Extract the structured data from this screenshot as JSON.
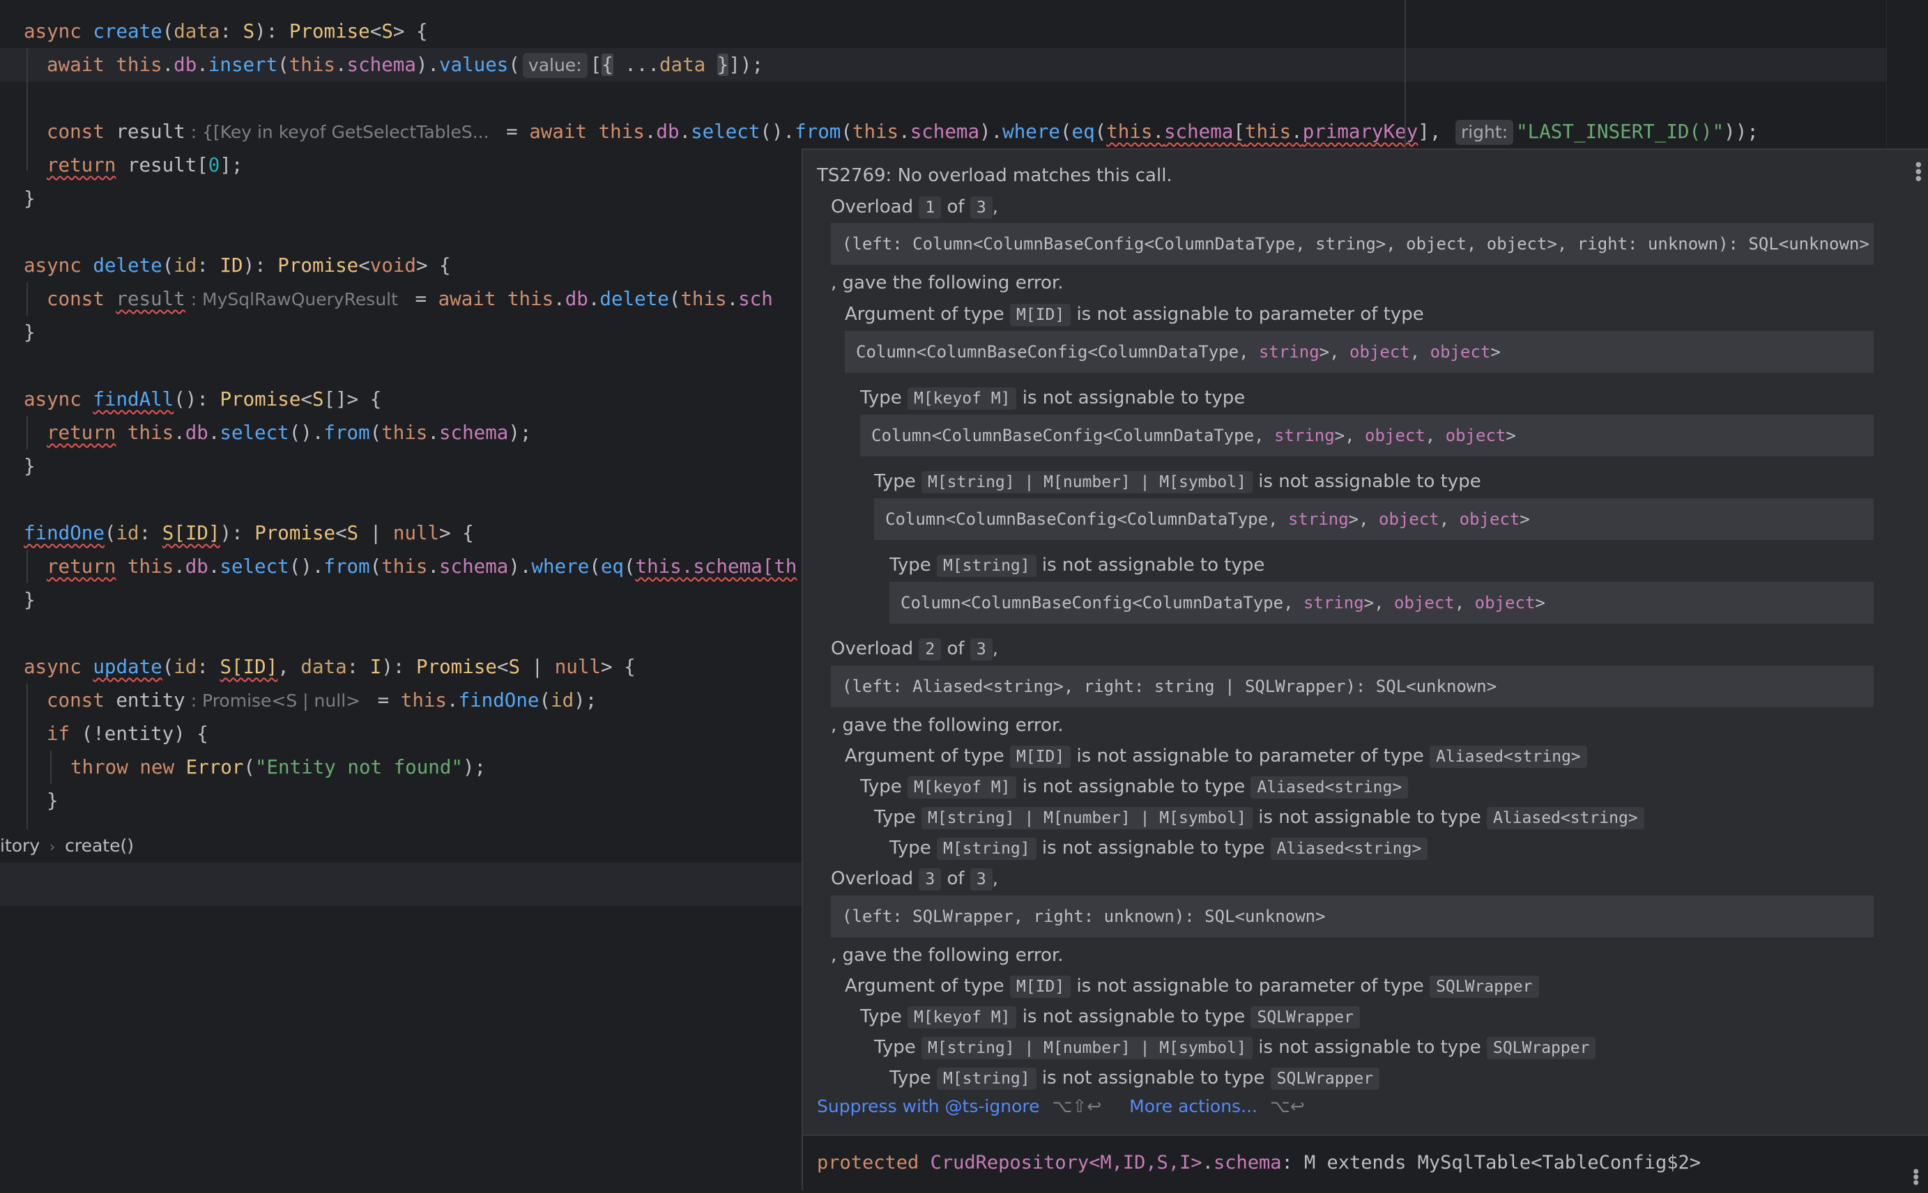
{
  "editor": {
    "l1": {
      "a": "async ",
      "b": "create",
      "c": "(",
      "d": "data",
      "e": ": ",
      "f": "S",
      "g": "): ",
      "h": "Promise",
      "i": "<",
      "j": "S",
      "k": "> {"
    },
    "l2": {
      "a": "await ",
      "b": "this",
      "c": ".",
      "d": "db",
      "e": ".",
      "f": "insert",
      "g": "(",
      "h": "this",
      "i": ".",
      "j": "schema",
      "k": ").",
      "l": "values",
      "m": "(",
      "hint": "value:",
      "n": "[",
      "o": "{",
      "p": " ...",
      "q": "data",
      "r": " ",
      "s": "}",
      "t": "]);"
    },
    "l4": {
      "a": "const ",
      "b": "result",
      "hint": ": {[Key in keyof GetSelectTableS...",
      "c": " = ",
      "d": "await ",
      "e": "this",
      "f": ".",
      "g": "db",
      "h": ".",
      "i": "select",
      "j": "().",
      "k": "from",
      "l": "(",
      "m": "this",
      "n": ".",
      "o": "schema",
      "p": ").",
      "q": "where",
      "r": "(",
      "s": "eq",
      "t": "(",
      "u": "this",
      "v": ".",
      "w": "schema",
      "x": "[",
      "y": "this",
      "z": ".",
      "aa": "primaryKey",
      "ab": "], ",
      "hint2": "right:",
      "ac": "\"LAST_INSERT_ID()\"",
      "ad": "));"
    },
    "l5": {
      "a": "return",
      "b": " result[",
      "c": "0",
      "d": "];"
    },
    "l6": "}",
    "l8": {
      "a": "async ",
      "b": "delete",
      "c": "(",
      "d": "id",
      "e": ": ",
      "f": "ID",
      "g": "): ",
      "h": "Promise",
      "i": "<",
      "j": "void",
      "k": "> {"
    },
    "l9": {
      "a": "const ",
      "b": "result",
      "hint": ": MySqlRawQueryResult",
      "c": " = ",
      "d": "await ",
      "e": "this",
      "f": ".",
      "g": "db",
      "h": ".",
      "i": "delete",
      "j": "(",
      "k": "this",
      "l": ".",
      "m": "sch"
    },
    "l10": "}",
    "l12": {
      "a": "async ",
      "b": "findAll",
      "c": "(): ",
      "d": "Promise",
      "e": "<",
      "f": "S",
      "g": "[]> {"
    },
    "l13": {
      "a": "return",
      "b": " ",
      "c": "this",
      "d": ".",
      "e": "db",
      "f": ".",
      "g": "select",
      "h": "().",
      "i": "from",
      "j": "(",
      "k": "this",
      "l": ".",
      "m": "schema",
      "n": ");"
    },
    "l14": "}",
    "l16": {
      "a": "findOne",
      "b": "(",
      "c": "id",
      "d": ": ",
      "e": "S[ID]",
      "f": "): ",
      "g": "Promise",
      "h": "<",
      "i": "S",
      "j": " | ",
      "k": "null",
      "l": "> {"
    },
    "l17": {
      "a": "return",
      "b": " ",
      "c": "this",
      "d": ".",
      "e": "db",
      "f": ".",
      "g": "select",
      "h": "().",
      "i": "from",
      "j": "(",
      "k": "this",
      "l": ".",
      "m": "schema",
      "n": ").",
      "o": "where",
      "p": "(",
      "q": "eq",
      "r": "(",
      "s": "this.schema[th"
    },
    "l18": "}",
    "l20": {
      "a": "async ",
      "b": "update",
      "c": "(",
      "d": "id",
      "e": ": ",
      "f": "S[ID]",
      "g": ", ",
      "h": "data",
      "i": ": ",
      "j": "I",
      "k": "): ",
      "l": "Promise",
      "m": "<",
      "n": "S",
      "o": " | ",
      "p": "null",
      "q": "> {"
    },
    "l21": {
      "a": "const ",
      "b": "entity",
      "hint": ": Promise<S | null>",
      "c": " = ",
      "d": "this",
      "e": ".",
      "f": "findOne",
      "g": "(",
      "h": "id",
      "i": ");"
    },
    "l22": {
      "a": "if ",
      "b": "(!entity) {"
    },
    "l23": {
      "a": "throw new ",
      "b": "Error",
      "c": "(",
      "d": "\"Entity not found\"",
      "e": ");"
    },
    "l24": "}"
  },
  "breadcrumb": {
    "item1": "itory",
    "item2": "create()"
  },
  "popup": {
    "title": "TS2769: No overload matches this call.",
    "overload_word": "Overload",
    "of_word": "of",
    "comma": ",",
    "gave_error": ", gave the following error.",
    "arg_type": "Argument of type",
    "not_assignable_param": "is not assignable to parameter of type",
    "type_word": "Type",
    "not_assignable_type": "is not assignable to type",
    "o1": {
      "num": "1",
      "total": "3",
      "sig": "(left: Column<ColumnBaseConfig<ColumnDataType, string>, object, object>, right: unknown): SQL<unknown>",
      "c_mid": "M[ID]",
      "c_keyof": "M[keyof M]",
      "c_union": "M[string] | M[number] | M[symbol]",
      "c_str": "M[string]",
      "col_a": "Column<ColumnBaseConfig<ColumnDataType, ",
      "col_s": "string",
      "col_b": ">, ",
      "col_o1": "object",
      "col_c": ", ",
      "col_o2": "object",
      "col_d": ">"
    },
    "o2": {
      "num": "2",
      "total": "3",
      "sig": "(left: Aliased<string>, right: string | SQLWrapper): SQL<unknown>",
      "aliased": "Aliased<string>"
    },
    "o3": {
      "num": "3",
      "total": "3",
      "sig": "(left: SQLWrapper, right: unknown): SQL<unknown>",
      "wrapper": "SQLWrapper"
    },
    "actions": {
      "suppress": "Suppress with @ts-ignore",
      "suppress_key": "⌥⇧↩",
      "more": "More actions...",
      "more_key": "⌥↩"
    },
    "signature": {
      "a": "protected ",
      "b": "CrudRepository<M,ID,S,I>",
      "c": ".",
      "d": "schema",
      "e": ": M extends MySqlTable<TableConfig$2>"
    }
  }
}
